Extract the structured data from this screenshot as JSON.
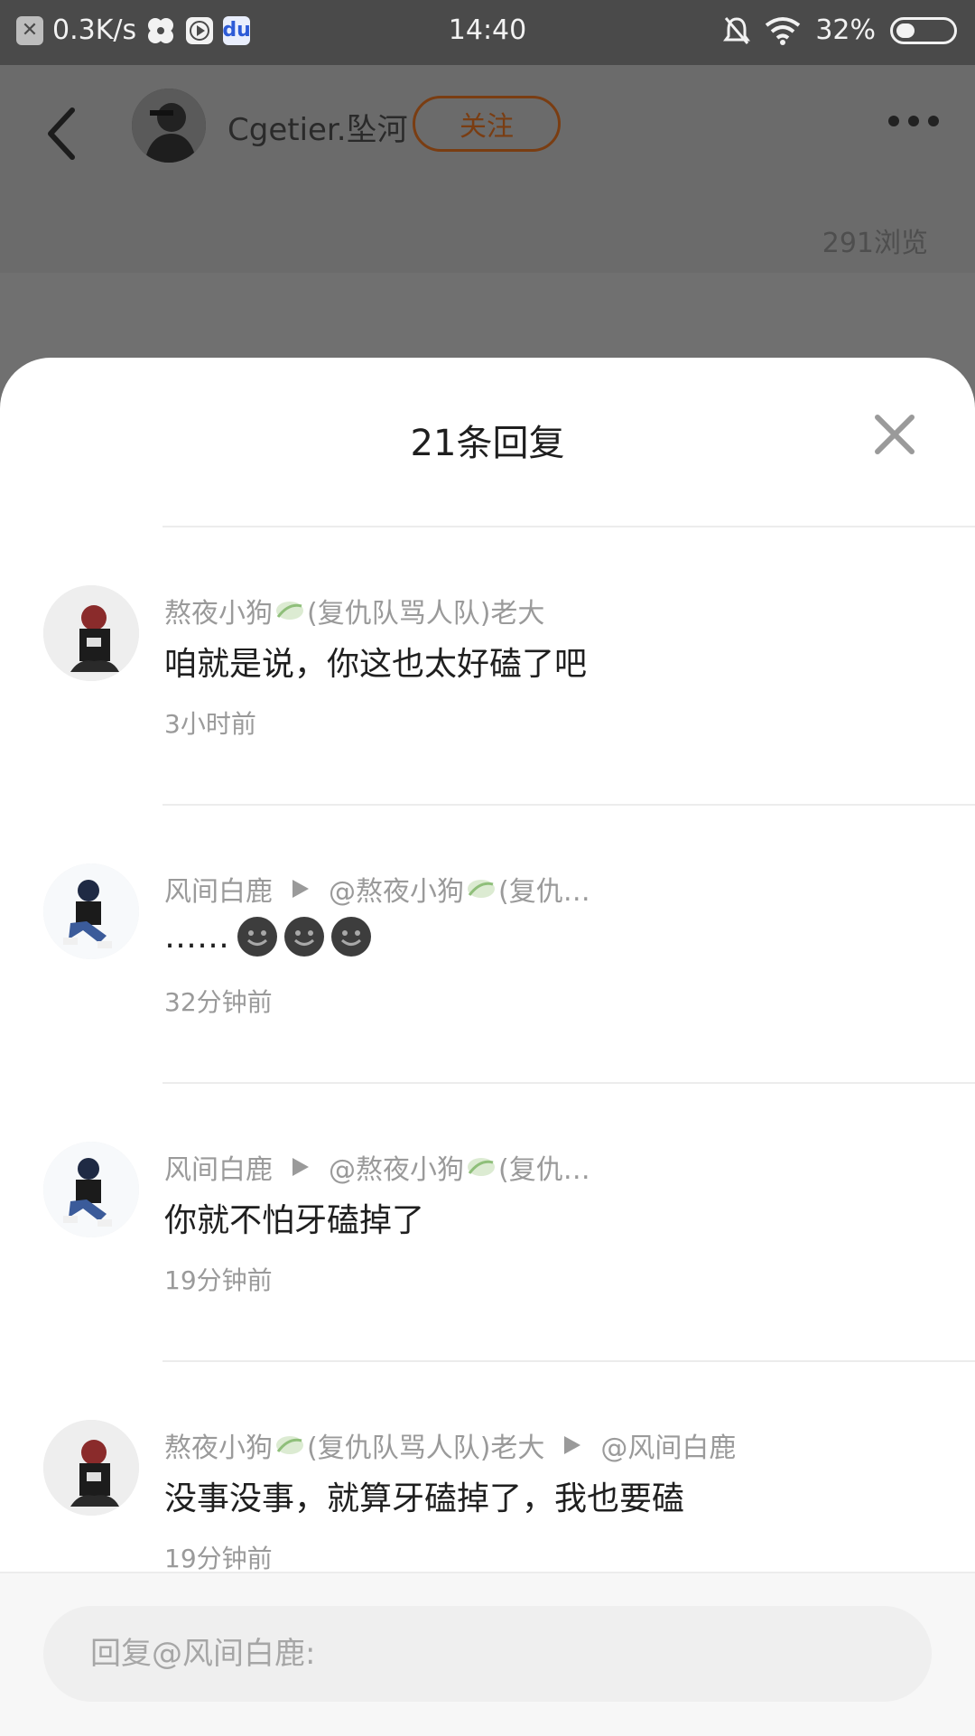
{
  "status_bar": {
    "net_speed": "0.3K/s",
    "time": "14:40",
    "battery": "32%",
    "battery_level": 0.32
  },
  "header": {
    "author_name": "Cgetier.坠河",
    "follow_label": "关注",
    "views": "291浏览"
  },
  "sheet": {
    "title": "21条回复"
  },
  "replies": [
    {
      "author": "熬夜小狗",
      "author_suffix": "(复仇队骂人队)老大",
      "target": "",
      "content": "咱就是说，你这也太好磕了吧",
      "time": "3小时前",
      "emoji_count": 0
    },
    {
      "author": "风间白鹿",
      "author_suffix": "",
      "target": "@熬夜小狗",
      "target_suffix": "(复仇…",
      "content": "……",
      "time": "32分钟前",
      "emoji_count": 3
    },
    {
      "author": "风间白鹿",
      "author_suffix": "",
      "target": "@熬夜小狗",
      "target_suffix": "(复仇…",
      "content": "你就不怕牙磕掉了",
      "time": "19分钟前",
      "emoji_count": 0
    },
    {
      "author": "熬夜小狗",
      "author_suffix": "(复仇队骂人队)老大",
      "target": "@风间白鹿",
      "target_suffix": "",
      "content": "没事没事，就算牙磕掉了，我也要磕",
      "time": "19分钟前",
      "emoji_count": 0
    }
  ],
  "input": {
    "placeholder": "回复@风间白鹿:"
  },
  "colors": {
    "follow": "#7a3d12",
    "meta_text": "#9a9a9a",
    "leaf": "#8fbf7a"
  }
}
